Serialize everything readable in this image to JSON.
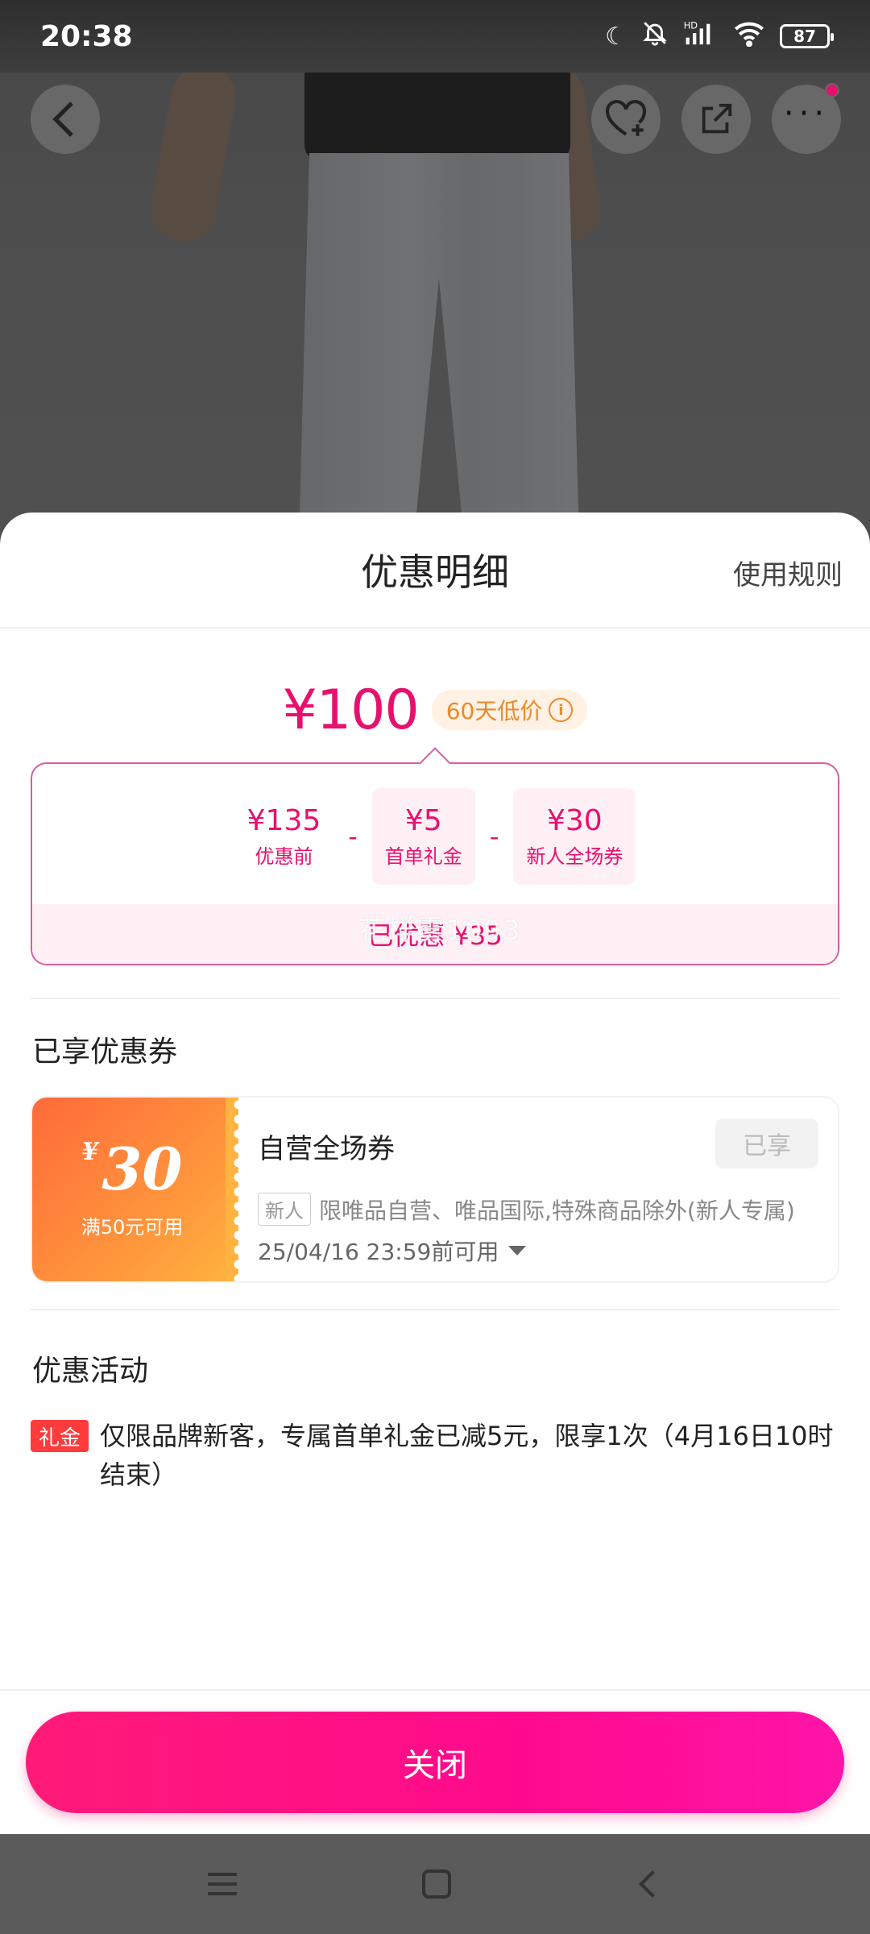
{
  "status_bar": {
    "time": "20:38",
    "icons": [
      "moon-icon",
      "mute-bell-icon",
      "signal-hd-icon",
      "wifi-icon"
    ],
    "battery": "87"
  },
  "header_actions": {
    "icons": [
      "back-icon",
      "favorite-add-icon",
      "share-icon",
      "more-icon"
    ]
  },
  "sheet": {
    "title": "优惠明细",
    "rules_link": "使用规则"
  },
  "price": {
    "final": "¥100",
    "badge": "60天低价",
    "badge_icon": "info-icon"
  },
  "breakdown": {
    "items": [
      {
        "amount": "¥135",
        "label": "优惠前"
      },
      {
        "amount": "¥5",
        "label": "首单礼金"
      },
      {
        "amount": "¥30",
        "label": "新人全场券"
      }
    ],
    "operator": "-",
    "saved": "已优惠 ¥35",
    "watermark": "花样雾1093"
  },
  "coupons_section": {
    "title": "已享优惠券",
    "coupon": {
      "currency": "¥",
      "value": "30",
      "condition": "满50元可用",
      "name": "自营全场券",
      "status": "已享",
      "tag": "新人",
      "description": "限唯品自营、唯品国际,特殊商品除外(新人专属)",
      "expiry": "25/04/16 23:59前可用"
    }
  },
  "activities_section": {
    "title": "优惠活动",
    "items": [
      {
        "tag": "礼金",
        "text": "仅限品牌新客，专属首单礼金已减5元，限享1次（4月16日10时结束）"
      }
    ]
  },
  "footer": {
    "close_label": "关闭"
  },
  "colors": {
    "accent": "#e8106e",
    "coupon_orange": "#ff7a3a",
    "gift_red": "#ff3b3b"
  }
}
